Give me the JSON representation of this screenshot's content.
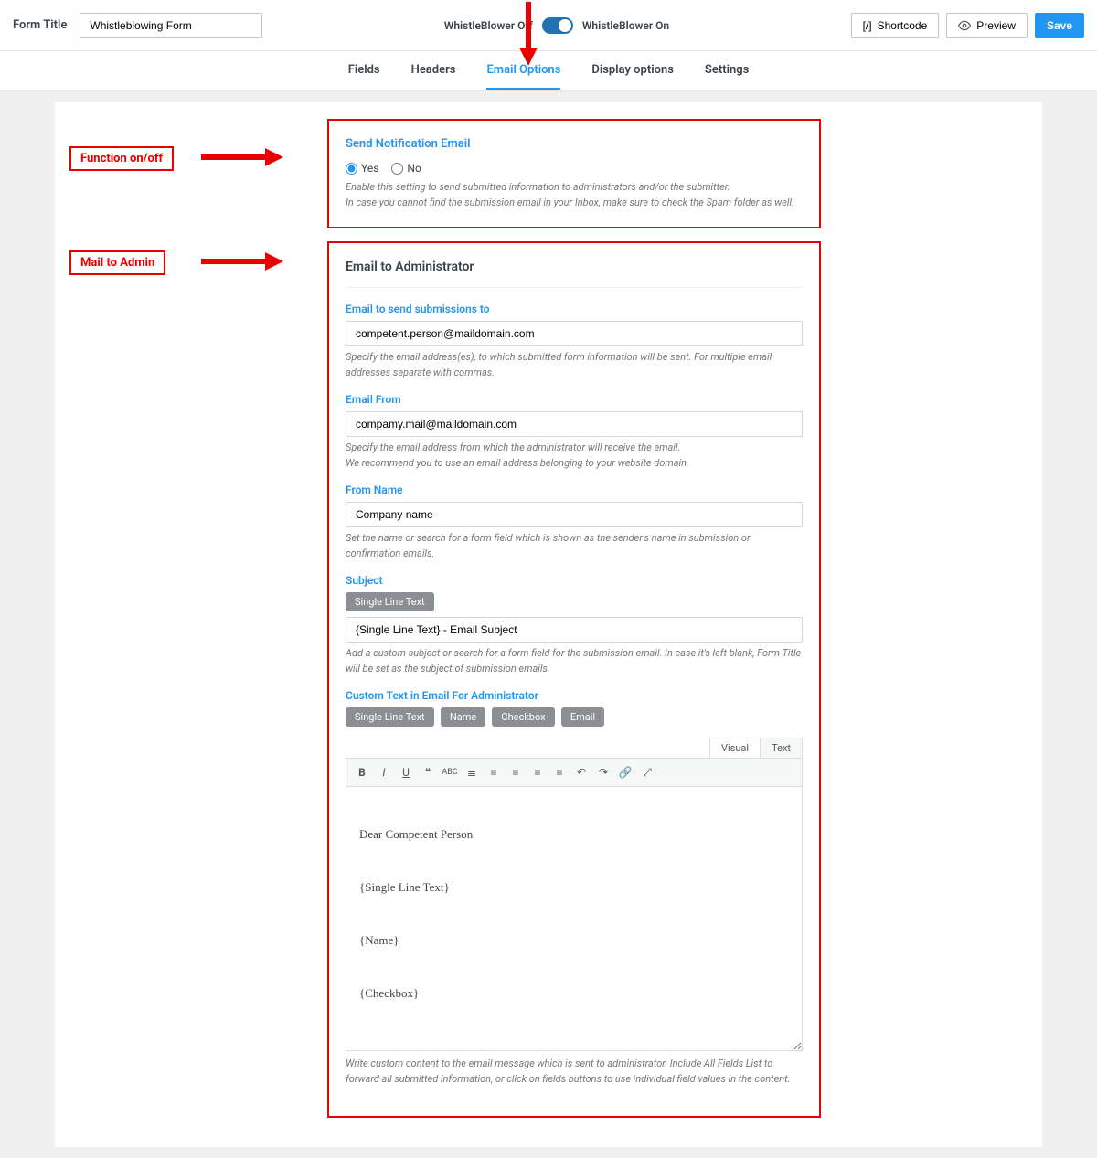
{
  "header": {
    "form_title_label": "Form Title",
    "form_title_value": "Whistleblowing Form",
    "toggle_off_label": "WhistleBlower Off",
    "toggle_on_label": "WhistleBlower On",
    "shortcode_btn": "Shortcode",
    "preview_btn": "Preview",
    "save_btn": "Save"
  },
  "tabs": [
    "Fields",
    "Headers",
    "Email Options",
    "Display options",
    "Settings"
  ],
  "active_tab": "Email Options",
  "annotations": {
    "function": "Function on/off",
    "mail_admin": "Mail to Admin"
  },
  "notification": {
    "title": "Send Notification Email",
    "opt_yes": "Yes",
    "opt_no": "No",
    "help1": "Enable this setting to send submitted information to administrators and/or the submitter.",
    "help2": "In case you cannot find the submission email in your Inbox, make sure to check the Spam folder as well."
  },
  "admin_email": {
    "panel_title": "Email to Administrator",
    "send_to": {
      "label": "Email to send submissions to",
      "value": "competent.person@maildomain.com",
      "help": "Specify the email address(es), to which submitted form information will be sent. For multiple email addresses separate with commas."
    },
    "from": {
      "label": "Email From",
      "value": "compamy.mail@maildomain.com",
      "help1": "Specify the email address from which the administrator will receive the email.",
      "help2": "We recommend you to use an email address belonging to your website domain."
    },
    "from_name": {
      "label": "From Name",
      "value": "Company name",
      "help": "Set the name or search for a form field which is shown as the sender's name in submission or confirmation emails."
    },
    "subject": {
      "label": "Subject",
      "tag": "Single Line Text",
      "value": "{Single Line Text} - Email Subject",
      "help": "Add a custom subject or search for a form field for the submission email. In case it's left blank, Form Title will be set as the subject of submission emails."
    },
    "custom_text": {
      "label": "Custom Text in Email For Administrator",
      "tags": [
        "Single Line Text",
        "Name",
        "Checkbox",
        "Email"
      ],
      "editor_tabs": {
        "visual": "Visual",
        "text": "Text"
      },
      "body_lines": [
        "Dear Competent Person",
        "{Single Line Text}",
        "{Name}",
        "{Checkbox}"
      ],
      "help": "Write custom content to the email message which is sent to administrator. Include All Fields List to forward all submitted information, or click on fields buttons to use individual field values in the content."
    }
  }
}
